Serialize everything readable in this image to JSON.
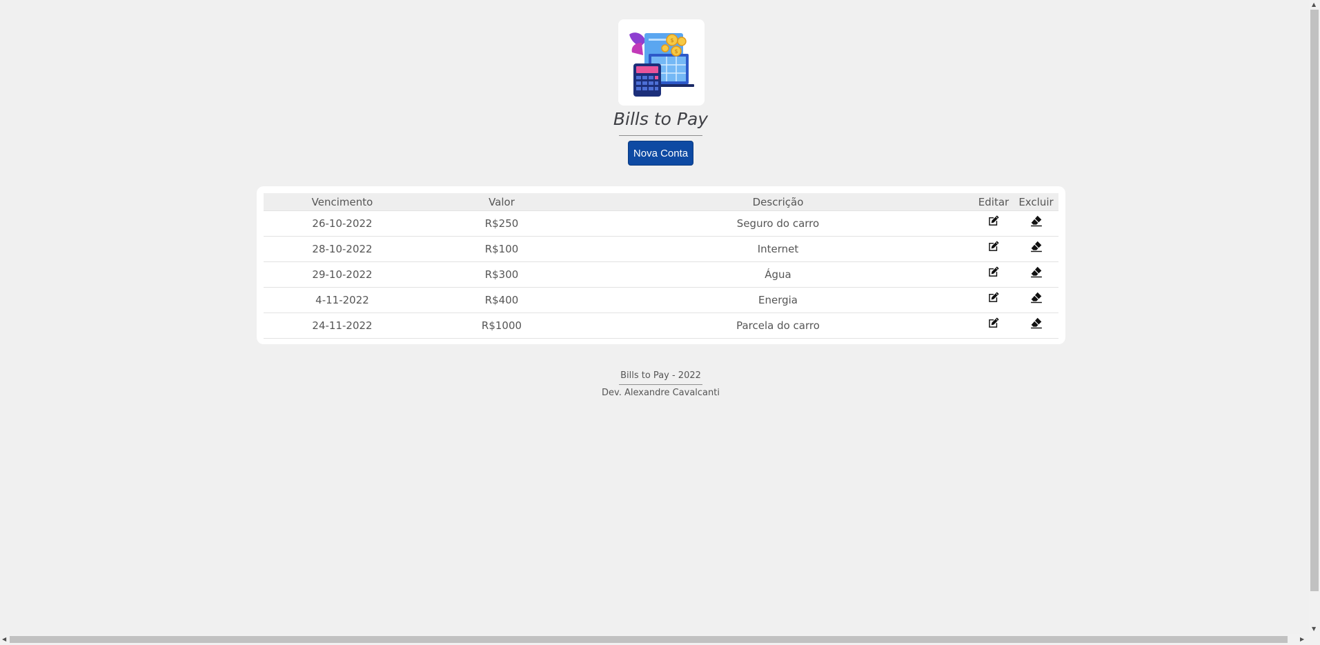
{
  "header": {
    "title": "Bills to Pay",
    "new_button_label": "Nova Conta",
    "logo_icon": "bills-calculator-laptop-illustration"
  },
  "table": {
    "columns": [
      "Vencimento",
      "Valor",
      "Descrição",
      "Editar",
      "Excluir"
    ],
    "rows": [
      {
        "date": "26-10-2022",
        "value": "R$250",
        "description": "Seguro do carro"
      },
      {
        "date": "28-10-2022",
        "value": "R$100",
        "description": "Internet"
      },
      {
        "date": "29-10-2022",
        "value": "R$300",
        "description": "Água"
      },
      {
        "date": "4-11-2022",
        "value": "R$400",
        "description": "Energia"
      },
      {
        "date": "24-11-2022",
        "value": "R$1000",
        "description": "Parcela do carro"
      }
    ],
    "edit_icon": "edit-icon",
    "delete_icon": "eraser-icon"
  },
  "footer": {
    "line1": "Bills to Pay - 2022",
    "line2": "Dev. Alexandre Cavalcanti"
  },
  "colors": {
    "background": "#f0f0f0",
    "button": "#0e4aa3",
    "card": "#ffffff",
    "text": "#555555"
  }
}
